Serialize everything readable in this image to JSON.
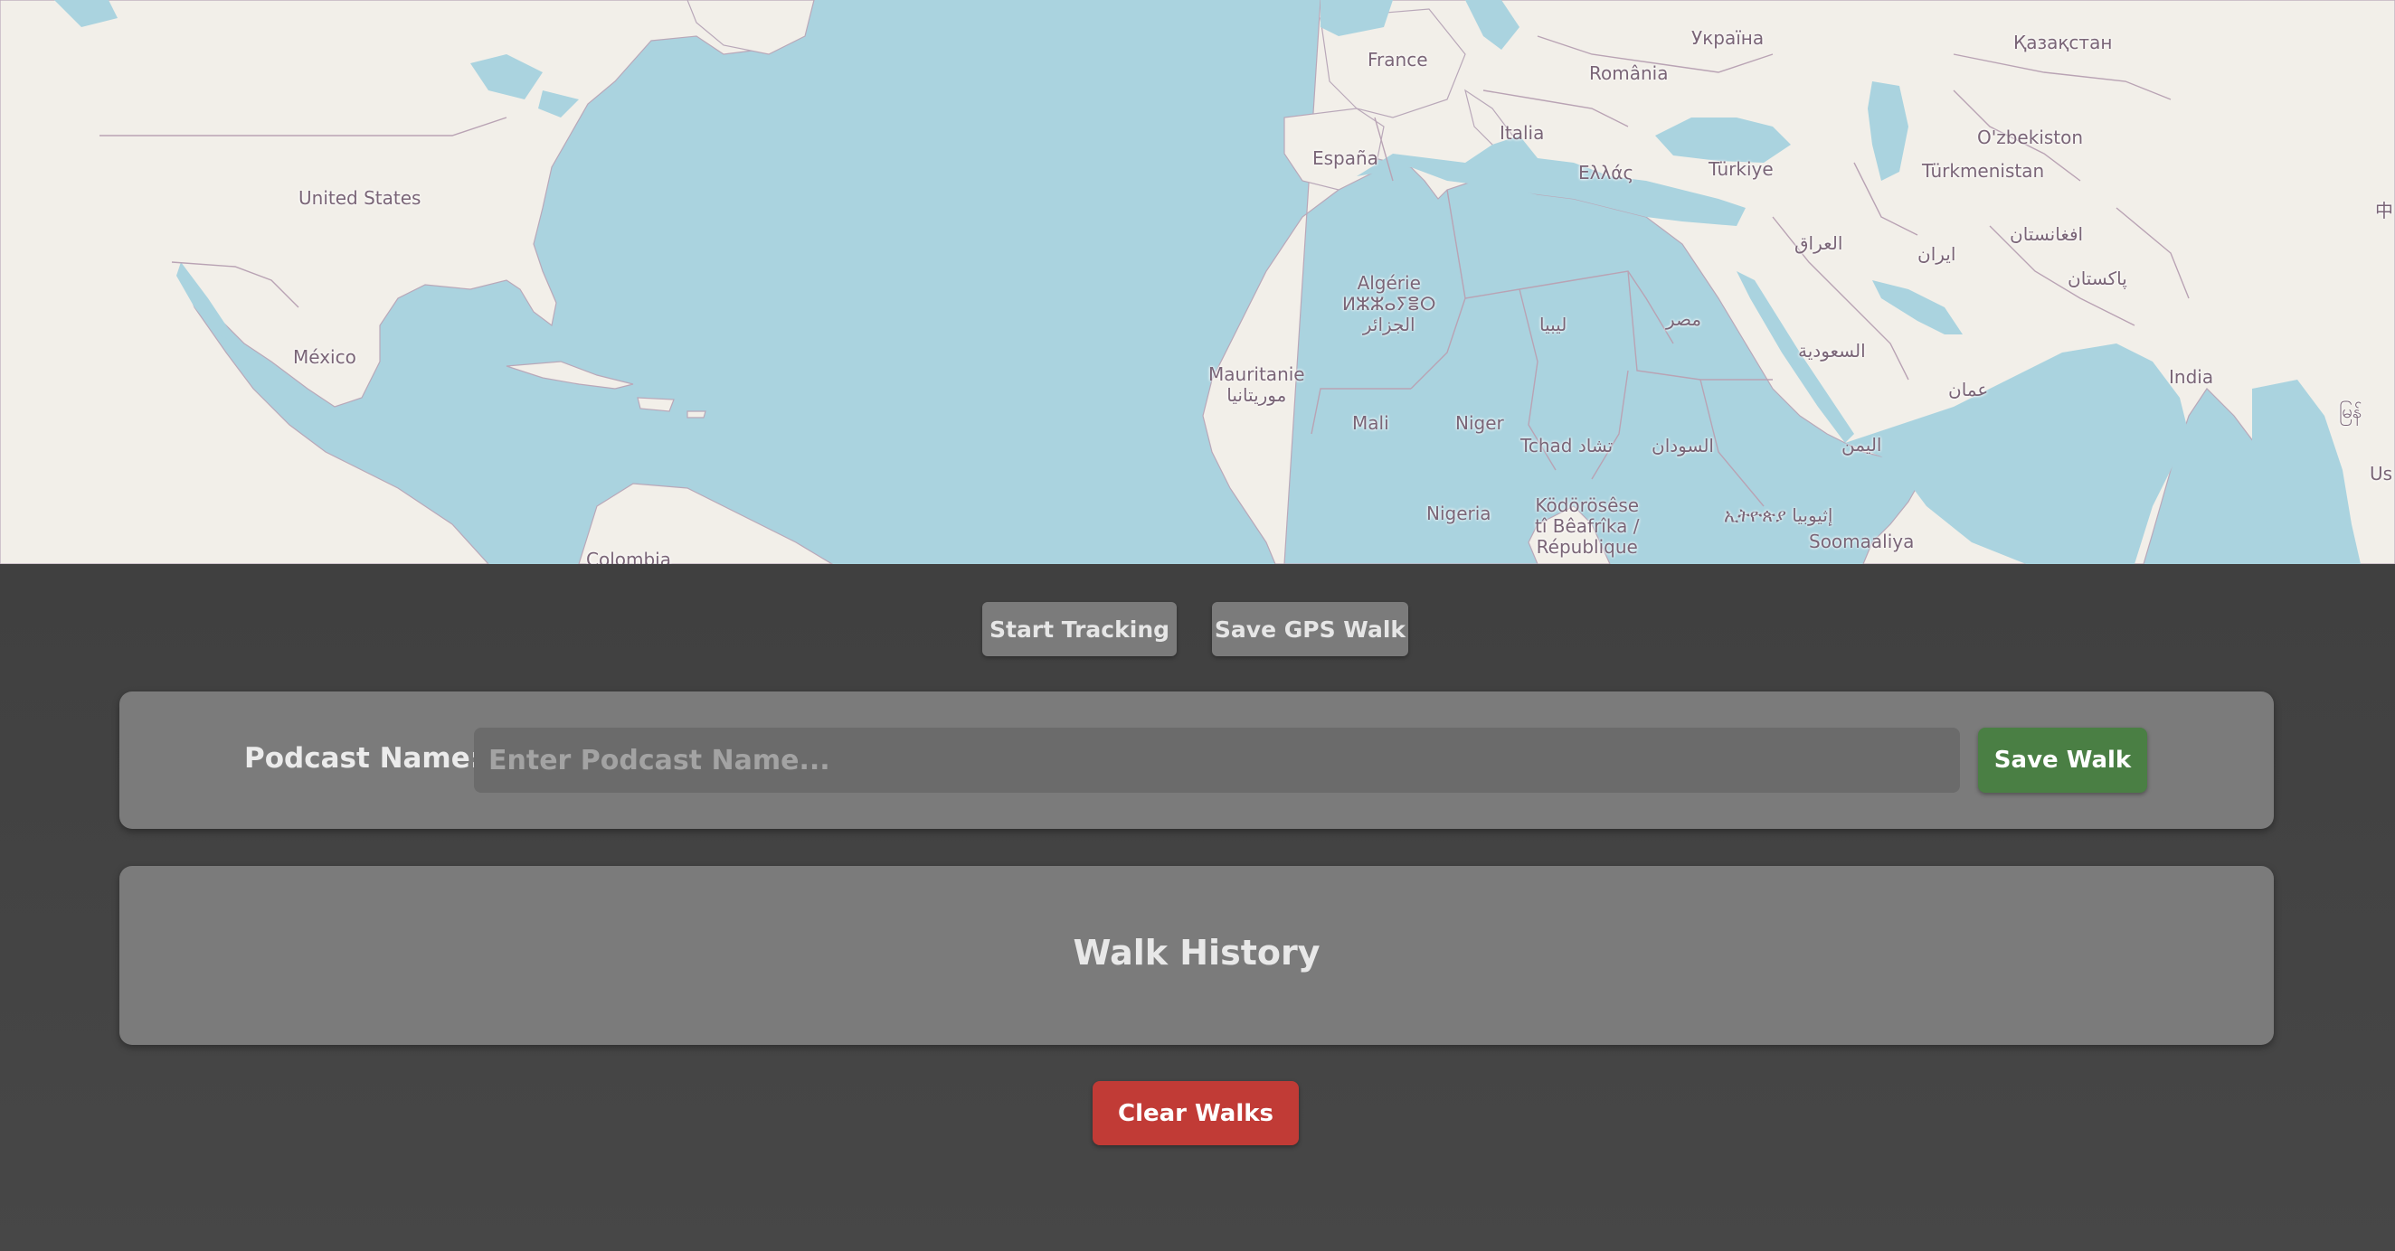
{
  "map": {
    "labels": [
      {
        "name": "label-united-states",
        "text": "United States"
      },
      {
        "name": "label-mexico",
        "text": "México"
      },
      {
        "name": "label-colombia",
        "text": "Colombia"
      },
      {
        "name": "label-france",
        "text": "France"
      },
      {
        "name": "label-espana",
        "text": "España"
      },
      {
        "name": "label-italia",
        "text": "Italia"
      },
      {
        "name": "label-romania",
        "text": "România"
      },
      {
        "name": "label-ukraina",
        "text": "Україна"
      },
      {
        "name": "label-kazakhstan",
        "text": "Қазақстан"
      },
      {
        "name": "label-ellas",
        "text": "Ελλάς"
      },
      {
        "name": "label-turkiye",
        "text": "Türkiye"
      },
      {
        "name": "label-ozbekiston",
        "text": "O'zbekiston"
      },
      {
        "name": "label-turkmenistan",
        "text": "Türkmenistan"
      },
      {
        "name": "label-afghanistan",
        "text": "افغانستان"
      },
      {
        "name": "label-iran",
        "text": "ایران"
      },
      {
        "name": "label-iraq",
        "text": "العراق"
      },
      {
        "name": "label-pakistan",
        "text": "پاکستان"
      },
      {
        "name": "label-algerie",
        "text": "Algérie\nⵍⵣⵣⴰⵢⴻⵔ\nالجزائر"
      },
      {
        "name": "label-libya",
        "text": "ليبيا"
      },
      {
        "name": "label-egypt",
        "text": "مصر"
      },
      {
        "name": "label-saudi",
        "text": "السعودية"
      },
      {
        "name": "label-oman",
        "text": "عمان"
      },
      {
        "name": "label-india",
        "text": "India"
      },
      {
        "name": "label-mauritanie",
        "text": "Mauritanie\nموريتانيا"
      },
      {
        "name": "label-mali",
        "text": "Mali"
      },
      {
        "name": "label-niger",
        "text": "Niger"
      },
      {
        "name": "label-tchad",
        "text": "Tchad تشاد"
      },
      {
        "name": "label-sudan",
        "text": "السودان"
      },
      {
        "name": "label-yemen",
        "text": "اليمن"
      },
      {
        "name": "label-nigeria",
        "text": "Nigeria"
      },
      {
        "name": "label-kodorosese",
        "text": "Ködörösêse\ntî Bêafrîka /\nRépublique"
      },
      {
        "name": "label-ethiopia",
        "text": "ኢትዮጵያ إثيوبيا"
      },
      {
        "name": "label-somalia",
        "text": "Soomaaliya"
      },
      {
        "name": "label-china",
        "text": "中"
      },
      {
        "name": "label-myanmar",
        "text": "မြန်"
      },
      {
        "name": "label-us-edge",
        "text": "Us"
      }
    ]
  },
  "controls": {
    "start_tracking": "Start Tracking",
    "save_gps_walk": "Save GPS Walk"
  },
  "podcast": {
    "label": "Podcast Name:",
    "placeholder": "Enter Podcast Name...",
    "value": "",
    "save_button": "Save Walk"
  },
  "history": {
    "title": "Walk History"
  },
  "clear_button": "Clear Walks",
  "colors": {
    "water": "#aad3df",
    "land": "#f2efe9",
    "button_gray": "#7b7b7b",
    "save_green": "#4a7f44",
    "clear_red": "#c13b36"
  }
}
